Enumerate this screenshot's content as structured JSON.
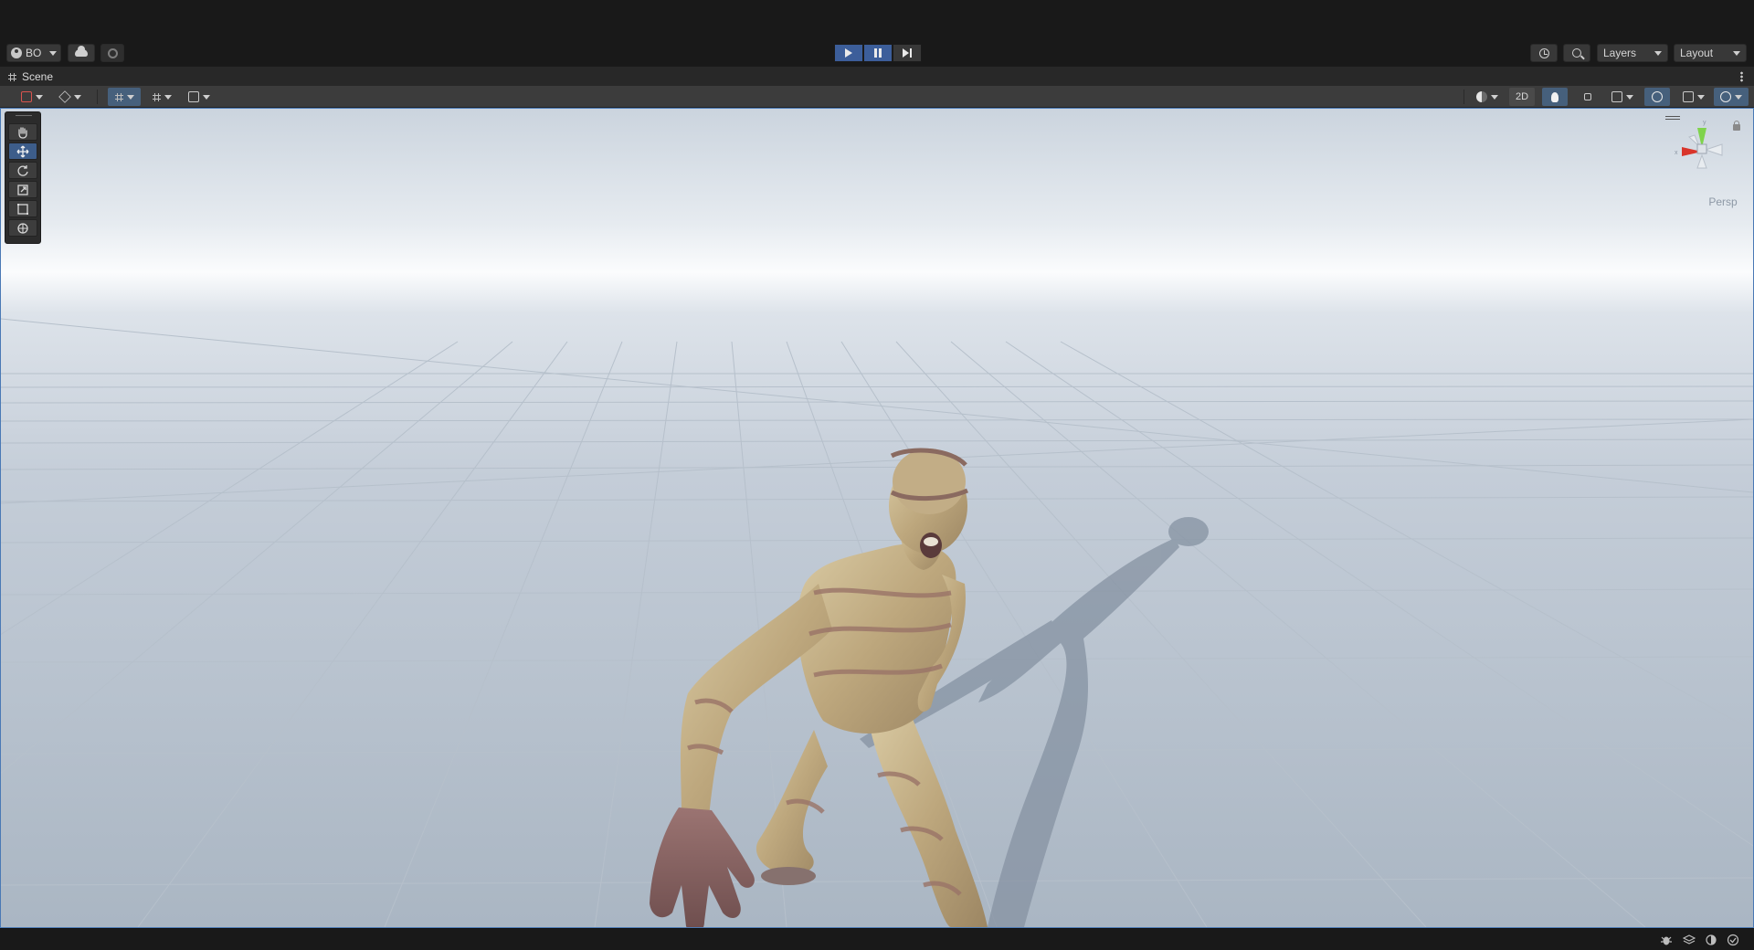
{
  "toolbar": {
    "account_label": "BO",
    "layers_label": "Layers",
    "layout_label": "Layout",
    "play_state": "playing"
  },
  "scene_tab": {
    "title": "Scene"
  },
  "scene_toolbar": {
    "mode_2d_label": "2D"
  },
  "viewport": {
    "projection_label": "Persp"
  },
  "colors": {
    "accent_blue": "#3c5e9a",
    "viewport_border": "#4a79b5",
    "gizmo_x": "#d9352b",
    "gizmo_y": "#7fd34c"
  },
  "icons": [
    "account-icon",
    "cloud-icon",
    "collab-icon",
    "play-icon",
    "pause-icon",
    "step-icon",
    "history-icon",
    "search-icon",
    "grid-icon",
    "hand-icon",
    "move-icon",
    "rotate-icon",
    "scale-icon",
    "rect-icon",
    "transform-icon",
    "lock-icon",
    "bug-icon",
    "layers-status-icon",
    "light-status-icon",
    "check-icon"
  ]
}
